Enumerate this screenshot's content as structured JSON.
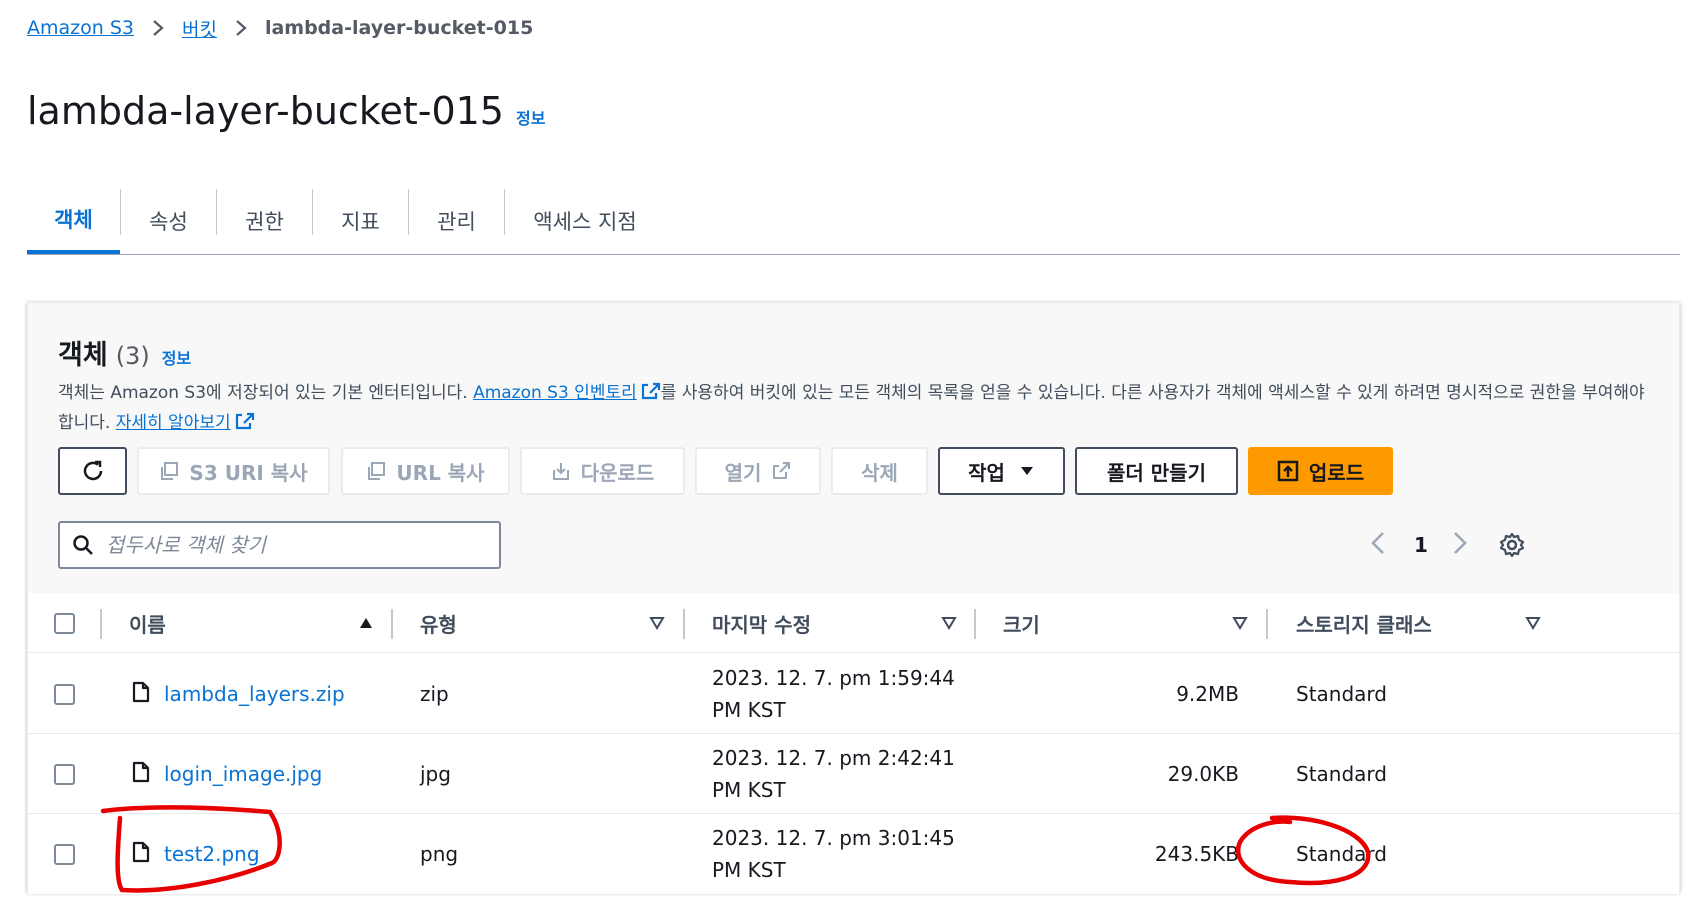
{
  "breadcrumb": {
    "items": [
      "Amazon S3",
      "버킷"
    ],
    "current": "lambda-layer-bucket-015"
  },
  "page_title": "lambda-layer-bucket-015",
  "info_label": "정보",
  "tabs": [
    "객체",
    "속성",
    "권한",
    "지표",
    "관리",
    "액세스 지점"
  ],
  "objects_panel": {
    "heading": "객체",
    "count": "(3)",
    "info_label": "정보",
    "description_part1": "객체는 Amazon S3에 저장되어 있는 기본 엔터티입니다. ",
    "description_link": "Amazon S3 인벤토리",
    "description_part2": "를 사용하여 버킷에 있는 모든 객체의 목록을 얻을 수 있습니다. 다른 사용자가 객체에 액세스할 수 있게 하려면 명시적으로 권한을 부여해야 합니다. ",
    "description_link2": "자세히 알아보기"
  },
  "toolbar": {
    "copy_s3_uri": "S3 URI 복사",
    "copy_url": "URL 복사",
    "download": "다운로드",
    "open": "열기",
    "delete": "삭제",
    "actions": "작업",
    "create_folder": "폴더 만들기",
    "upload": "업로드"
  },
  "search": {
    "placeholder": "접두사로 객체 찾기"
  },
  "pagination": {
    "page": "1"
  },
  "table": {
    "headers": [
      "이름",
      "유형",
      "마지막 수정",
      "크기",
      "스토리지 클래스"
    ],
    "rows": [
      {
        "name": "lambda_layers.zip",
        "type": "zip",
        "modified_line1": "2023. 12. 7. pm 1:59:44",
        "modified_line2": "PM KST",
        "size": "9.2MB",
        "storage": "Standard"
      },
      {
        "name": "login_image.jpg",
        "type": "jpg",
        "modified_line1": "2023. 12. 7. pm 2:42:41",
        "modified_line2": "PM KST",
        "size": "29.0KB",
        "storage": "Standard"
      },
      {
        "name": "test2.png",
        "type": "png",
        "modified_line1": "2023. 12. 7. pm 3:01:45",
        "modified_line2": "PM KST",
        "size": "243.5KB",
        "storage": "Standard"
      }
    ]
  },
  "colors": {
    "link": "#0972d3",
    "primary_button": "#ff9900",
    "annotation": "#e60000"
  }
}
